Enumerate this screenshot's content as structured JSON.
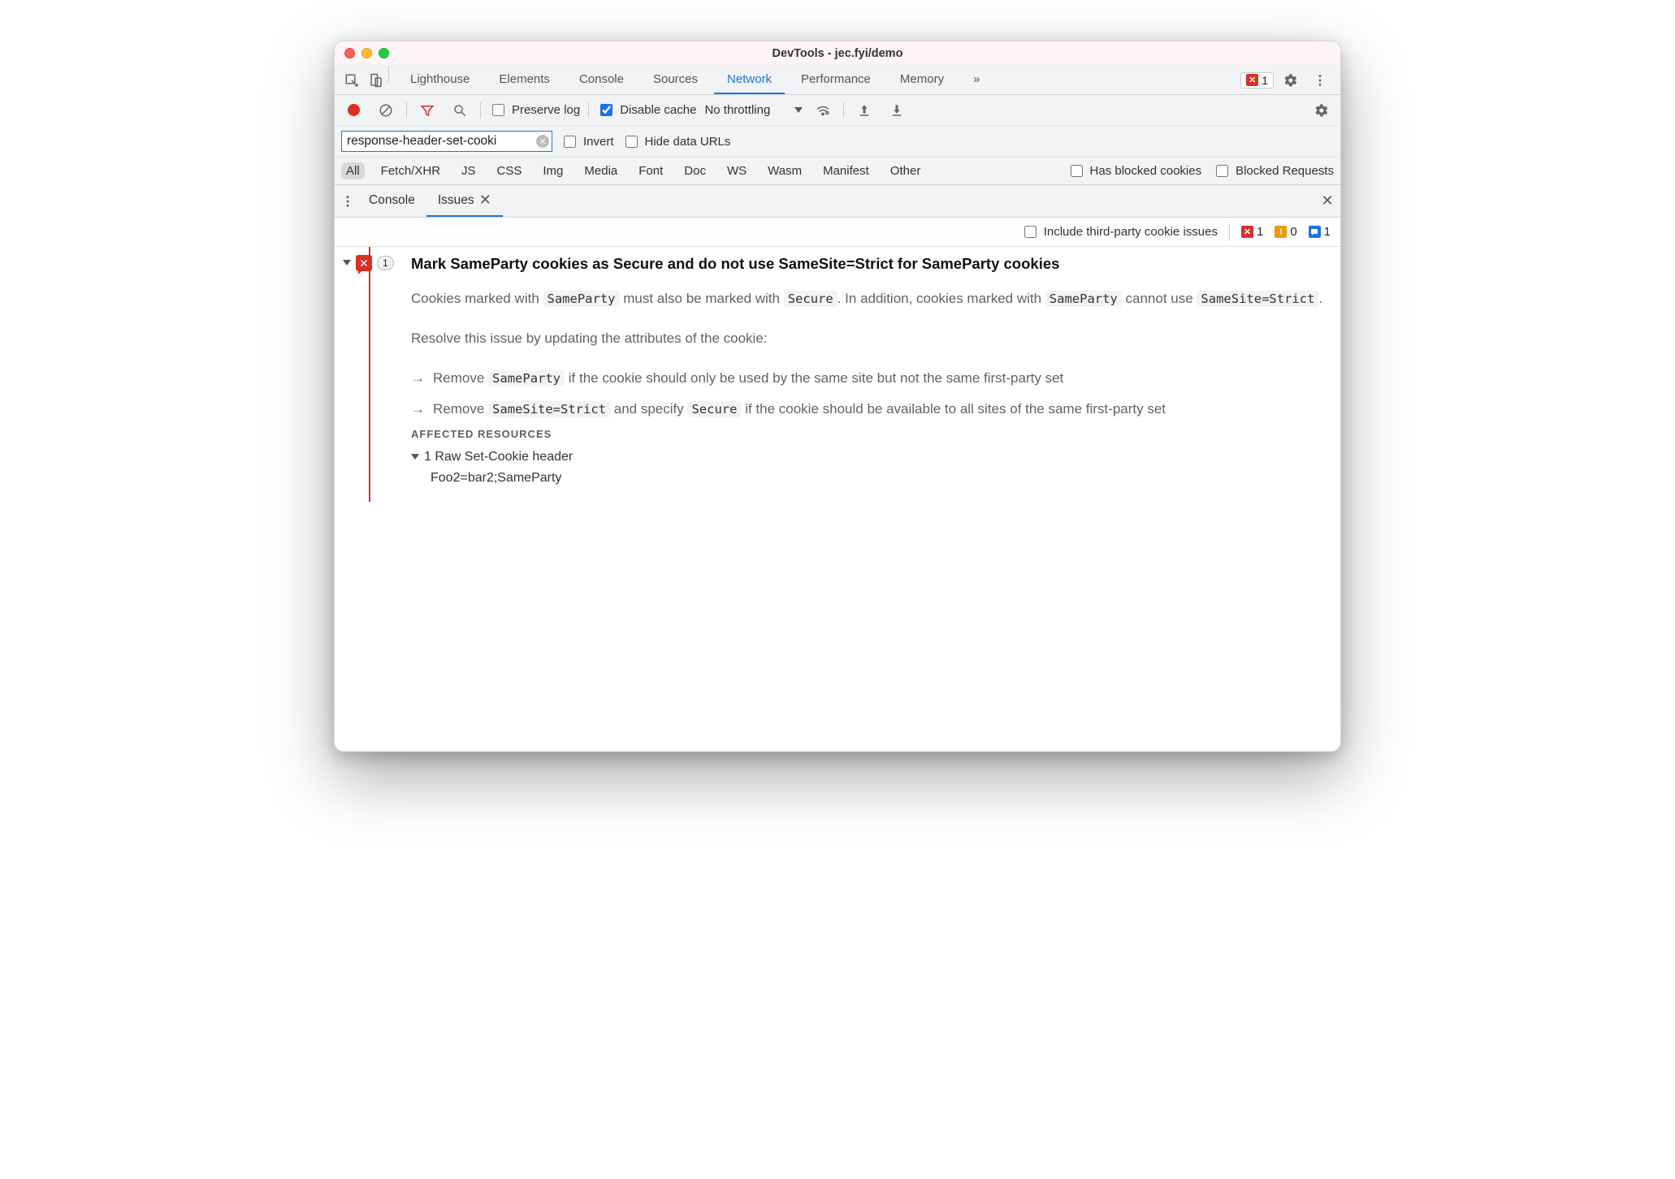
{
  "window": {
    "title": "DevTools - jec.fyi/demo"
  },
  "tabs": {
    "items": [
      "Lighthouse",
      "Elements",
      "Console",
      "Sources",
      "Network",
      "Performance",
      "Memory"
    ],
    "active": "Network",
    "overflow_glyph": "»",
    "error_count": "1"
  },
  "net_controls": {
    "preserve_log_label": "Preserve log",
    "preserve_log_checked": false,
    "disable_cache_label": "Disable cache",
    "disable_cache_checked": true,
    "throttling_label": "No throttling"
  },
  "filter": {
    "value": "response-header-set-cooki",
    "invert_label": "Invert",
    "hide_urls_label": "Hide data URLs"
  },
  "type_filter": {
    "active": "All",
    "types": [
      "All",
      "Fetch/XHR",
      "JS",
      "CSS",
      "Img",
      "Media",
      "Font",
      "Doc",
      "WS",
      "Wasm",
      "Manifest",
      "Other"
    ],
    "has_blocked_cookies_label": "Has blocked cookies",
    "blocked_requests_label": "Blocked Requests"
  },
  "drawer": {
    "tabs": {
      "console": "Console",
      "issues": "Issues"
    }
  },
  "issues_toolbar": {
    "include_third_party_label": "Include third-party cookie issues",
    "counts": {
      "error": "1",
      "warning": "0",
      "info": "1"
    }
  },
  "issue": {
    "count": "1",
    "title": "Mark SameParty cookies as Secure and do not use SameSite=Strict for SameParty cookies",
    "p1_a": "Cookies marked with ",
    "p1_code1": "SameParty",
    "p1_b": " must also be marked with ",
    "p1_code2": "Secure",
    "p1_c": ". In addition, cookies marked with ",
    "p1_code3": "SameParty",
    "p1_d": " cannot use ",
    "p1_code4": "SameSite=Strict",
    "p1_e": ".",
    "p2": "Resolve this issue by updating the attributes of the cookie:",
    "li1_a": "Remove ",
    "li1_code": "SameParty",
    "li1_b": " if the cookie should only be used by the same site but not the same first-party set",
    "li2_a": "Remove ",
    "li2_code1": "SameSite=Strict",
    "li2_b": " and specify ",
    "li2_code2": "Secure",
    "li2_c": " if the cookie should be available to all sites of the same first-party set",
    "affected_label": "AFFECTED RESOURCES",
    "raw_header_label": "1 Raw Set-Cookie header",
    "raw_value": "Foo2=bar2;SameParty"
  }
}
